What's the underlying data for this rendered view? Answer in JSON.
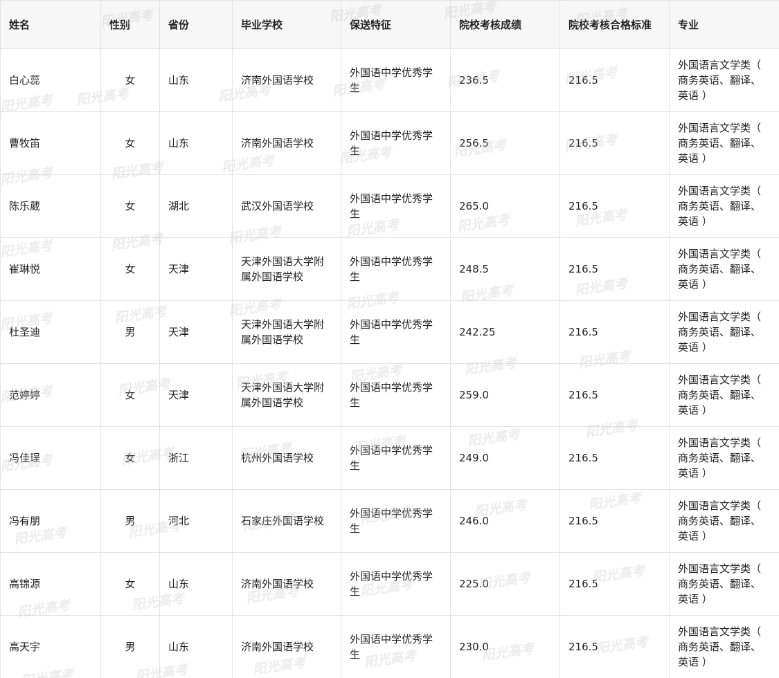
{
  "headers": {
    "name": "姓名",
    "gender": "性别",
    "province": "省份",
    "school": "毕业学校",
    "feature": "保送特征",
    "score": "院校考核成绩",
    "standard": "院校考核合格标准",
    "major": "专业"
  },
  "rows": [
    {
      "name": "白心蕊",
      "gender": "女",
      "province": "山东",
      "school": "济南外国语学校",
      "feature": "外国语中学优秀学生",
      "score": "236.5",
      "standard": "216.5",
      "major": "外国语言文学类（ 商务英语、翻译、英语 ）"
    },
    {
      "name": "曹牧笛",
      "gender": "女",
      "province": "山东",
      "school": "济南外国语学校",
      "feature": "外国语中学优秀学生",
      "score": "256.5",
      "standard": "216.5",
      "major": "外国语言文学类（ 商务英语、翻译、英语 ）"
    },
    {
      "name": "陈乐葳",
      "gender": "女",
      "province": "湖北",
      "school": "武汉外国语学校",
      "feature": "外国语中学优秀学生",
      "score": "265.0",
      "standard": "216.5",
      "major": "外国语言文学类（ 商务英语、翻译、英语 ）"
    },
    {
      "name": "崔琳悦",
      "gender": "女",
      "province": "天津",
      "school": "天津外国语大学附属外国语学校",
      "feature": "外国语中学优秀学生",
      "score": "248.5",
      "standard": "216.5",
      "major": "外国语言文学类（ 商务英语、翻译、英语 ）"
    },
    {
      "name": "杜圣迪",
      "gender": "男",
      "province": "天津",
      "school": "天津外国语大学附属外国语学校",
      "feature": "外国语中学优秀学生",
      "score": "242.25",
      "standard": "216.5",
      "major": "外国语言文学类（ 商务英语、翻译、英语 ）"
    },
    {
      "name": "范婷婷",
      "gender": "女",
      "province": "天津",
      "school": "天津外国语大学附属外国语学校",
      "feature": "外国语中学优秀学生",
      "score": "259.0",
      "standard": "216.5",
      "major": "外国语言文学类（ 商务英语、翻译、英语 ）"
    },
    {
      "name": "冯佳珵",
      "gender": "女",
      "province": "浙江",
      "school": "杭州外国语学校",
      "feature": "外国语中学优秀学生",
      "score": "249.0",
      "standard": "216.5",
      "major": "外国语言文学类（ 商务英语、翻译、英语 ）"
    },
    {
      "name": "冯有朋",
      "gender": "男",
      "province": "河北",
      "school": "石家庄外国语学校",
      "feature": "外国语中学优秀学生",
      "score": "246.0",
      "standard": "216.5",
      "major": "外国语言文学类（ 商务英语、翻译、英语 ）"
    },
    {
      "name": "高锦源",
      "gender": "女",
      "province": "山东",
      "school": "济南外国语学校",
      "feature": "外国语中学优秀学生",
      "score": "225.0",
      "standard": "216.5",
      "major": "外国语言文学类（ 商务英语、翻译、英语 ）"
    },
    {
      "name": "高天宇",
      "gender": "男",
      "province": "山东",
      "school": "济南外国语学校",
      "feature": "外国语中学优秀学生",
      "score": "230.0",
      "standard": "216.5",
      "major": "外国语言文学类（ 商务英语、翻译、英语 ）"
    }
  ],
  "watermark": {
    "text": "阳光高考",
    "color": "#c8c8c8"
  }
}
